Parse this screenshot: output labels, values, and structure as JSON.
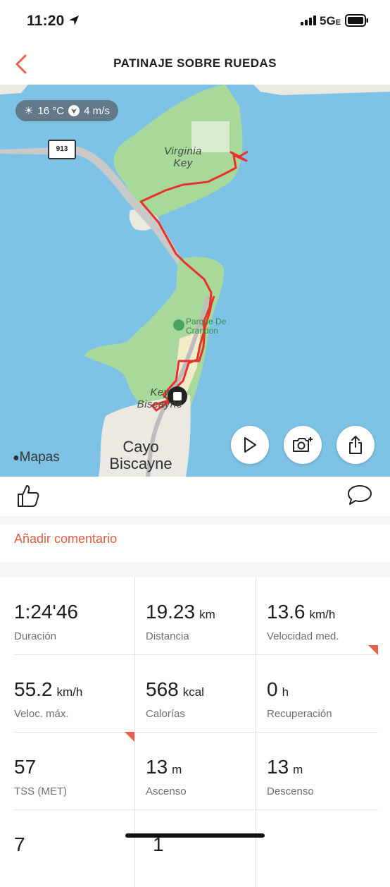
{
  "status": {
    "time": "11:20",
    "network": "5G",
    "network_suffix": "E"
  },
  "header": {
    "title": "PATINAJE SOBRE RUEDAS"
  },
  "map": {
    "weather": {
      "temp": "16 °C",
      "wind": "4 m/s"
    },
    "route_shield": "913",
    "labels": {
      "island1_line1": "Virginia",
      "island1_line2": "Key",
      "park_line1": "Parque De",
      "park_line2": "Crandon",
      "key_line1": "Key",
      "key_line2": "Biscayne",
      "city_line1": "Cayo",
      "city_line2": "Biscayne"
    },
    "brand": "Mapas",
    "colors": {
      "water": "#7ec3e6",
      "land": "#a8d99a",
      "route": "#e8312b",
      "urban": "#ece8e2"
    }
  },
  "actions": {
    "add_comment": "Añadir comentario"
  },
  "stats": [
    {
      "value": "1:24'46",
      "unit": "",
      "label": "Duración",
      "flag": false
    },
    {
      "value": "19.23",
      "unit": "km",
      "label": "Distancia",
      "flag": false
    },
    {
      "value": "13.6",
      "unit": "km/h",
      "label": "Velocidad med.",
      "flag": true
    },
    {
      "value": "55.2",
      "unit": "km/h",
      "label": "Veloc. máx.",
      "flag": false
    },
    {
      "value": "568",
      "unit": "kcal",
      "label": "Calorías",
      "flag": false
    },
    {
      "value": "0",
      "unit": "h",
      "label": "Recuperación",
      "flag": false
    },
    {
      "value": "57",
      "unit": "",
      "label": "TSS (MET)",
      "flag": true
    },
    {
      "value": "13",
      "unit": "m",
      "label": "Ascenso",
      "flag": false
    },
    {
      "value": "13",
      "unit": "m",
      "label": "Descenso",
      "flag": false
    },
    {
      "value": "7",
      "unit": "",
      "label": "",
      "flag": false
    },
    {
      "value": "1",
      "unit": "",
      "label": "",
      "flag": false
    },
    {
      "value": "",
      "unit": "",
      "label": "",
      "flag": false
    }
  ]
}
